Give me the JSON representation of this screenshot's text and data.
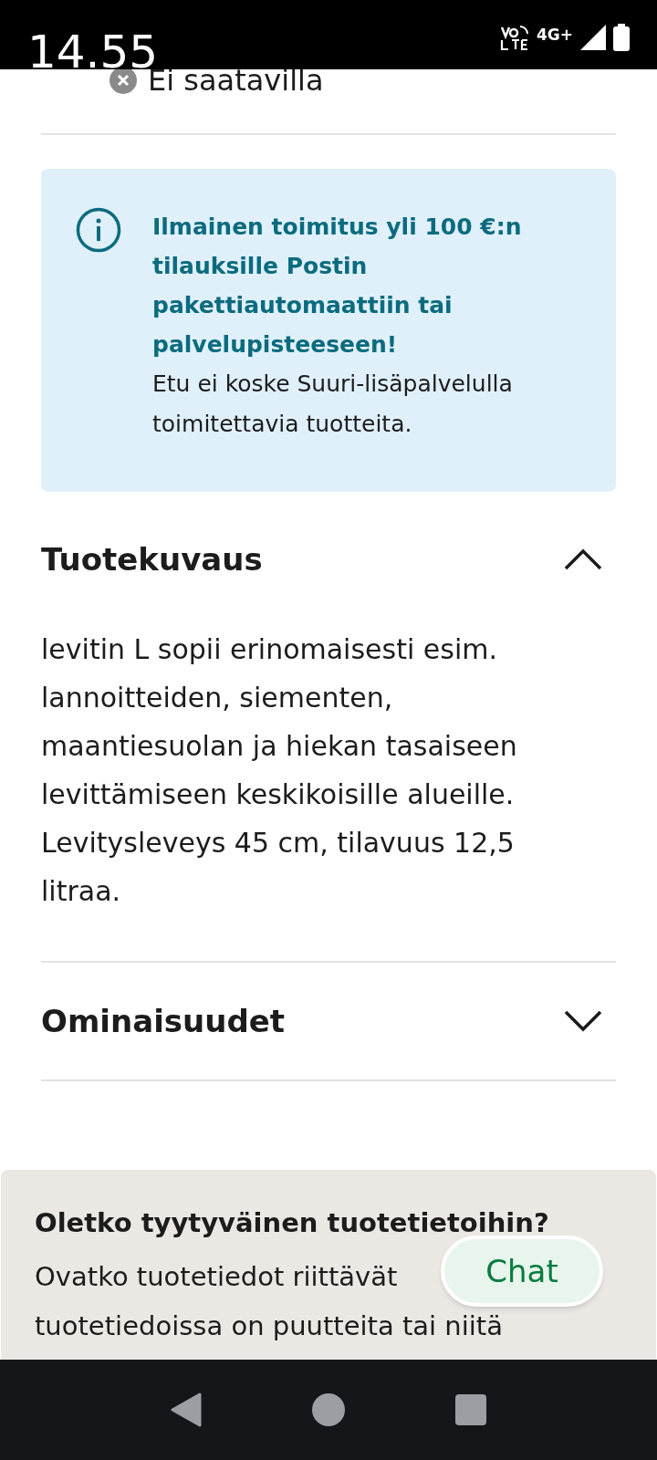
{
  "status_bar": {
    "time": "14.55",
    "network": "4G+"
  },
  "availability": {
    "text": "Ei saatavilla",
    "available": false
  },
  "info_box": {
    "title": "Ilmainen toimitus yli 100 €:n tilauksille Postin pakettiautomaattiin tai palvelupisteeseen!",
    "text": "Etu ei koske Suuri-lisäpalvelulla toimitettavia tuotteita."
  },
  "sections": [
    {
      "title": "Tuotekuvaus",
      "expanded": true,
      "text": "levitin L sopii erinomaisesti esim. lannoitteiden, siementen, maantiesuolan ja hiekan tasaiseen levittämiseen keskikoisille alueille. Levitysleveys 45 cm, tilavuus 12,5 litraa."
    },
    {
      "title": "Ominaisuudet",
      "expanded": false
    }
  ],
  "feedback": {
    "title": "Oletko tyytyväinen tuotetietoihin?",
    "lines": [
      "Ovatko tuotetiedot riittävät",
      "tuotetiedoissa on puutteita tai niitä"
    ]
  },
  "chat_button": {
    "label": "Chat"
  }
}
